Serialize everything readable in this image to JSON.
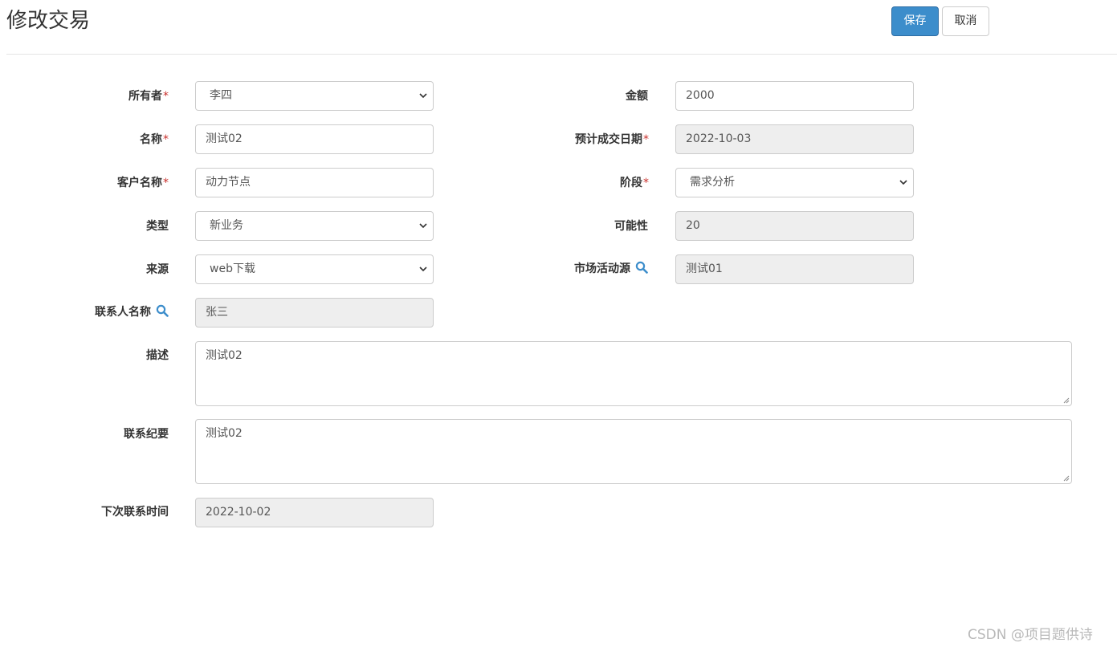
{
  "header": {
    "title": "修改交易",
    "save_label": "保存",
    "cancel_label": "取消"
  },
  "form": {
    "owner": {
      "label": "所有者",
      "required_mark": "*",
      "value": "李四"
    },
    "amount": {
      "label": "金额",
      "value": "2000"
    },
    "name": {
      "label": "名称",
      "required_mark": "*",
      "value": "测试02"
    },
    "expected_date": {
      "label": "预计成交日期",
      "required_mark": "*",
      "value": "2022-10-03"
    },
    "customer": {
      "label": "客户名称",
      "required_mark": "*",
      "value": "动力节点"
    },
    "stage": {
      "label": "阶段",
      "required_mark": "*",
      "value": "需求分析"
    },
    "type": {
      "label": "类型",
      "value": "新业务"
    },
    "possibility": {
      "label": "可能性",
      "value": "20"
    },
    "source": {
      "label": "来源",
      "value": "web下载"
    },
    "activity_source": {
      "label": "市场活动源",
      "value": "测试01",
      "icon": "search-icon"
    },
    "contact": {
      "label": "联系人名称",
      "value": "张三",
      "icon": "search-icon"
    },
    "description": {
      "label": "描述",
      "value": "测试02"
    },
    "contact_summary": {
      "label": "联系纪要",
      "value": "测试02"
    },
    "next_contact_time": {
      "label": "下次联系时间",
      "value": "2022-10-02"
    }
  },
  "watermark": "CSDN @项目题供诗",
  "colors": {
    "primary": "#3c8dcb",
    "required": "#c9302c",
    "icon": "#3c8dcb",
    "readonly_bg": "#eeeeee"
  }
}
